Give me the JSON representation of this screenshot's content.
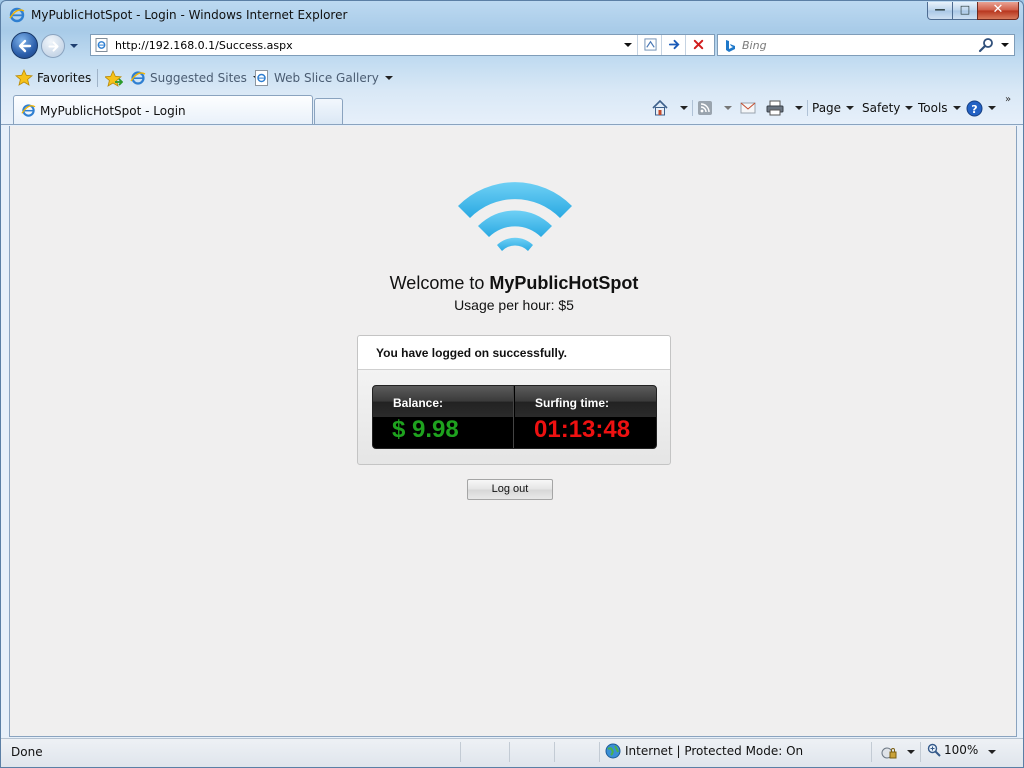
{
  "window": {
    "title": "MyPublicHotSpot - Login - Windows Internet Explorer"
  },
  "navbar": {
    "address": "http://192.168.0.1/Success.aspx",
    "search_placeholder": "Bing"
  },
  "favorites_bar": {
    "favorites_label": "Favorites",
    "items": [
      {
        "label": "Suggested Sites",
        "icon": "ie-icon"
      },
      {
        "label": "Web Slice Gallery",
        "icon": "ie-icon"
      }
    ]
  },
  "tabs": [
    {
      "label": "MyPublicHotSpot - Login",
      "active": true
    }
  ],
  "command_bar": {
    "page_label": "Page",
    "safety_label": "Safety",
    "tools_label": "Tools"
  },
  "page": {
    "welcome_prefix": "Welcome to",
    "brand": "MyPublicHotSpot",
    "usage_text": "Usage per hour:  $5",
    "success_message": "You have logged on successfully.",
    "balance_label": "Balance:",
    "balance_value": "$ 9.98",
    "time_label": "Surfing time:",
    "time_value": "01:13:48",
    "logout_label": "Log out"
  },
  "statusbar": {
    "status": "Done",
    "zone": "Internet | Protected Mode: On",
    "zoom": "100%"
  },
  "colors": {
    "wifi_blue": "#3fb7ea",
    "balance_green": "#1ea21e",
    "time_red": "#ee1111"
  }
}
